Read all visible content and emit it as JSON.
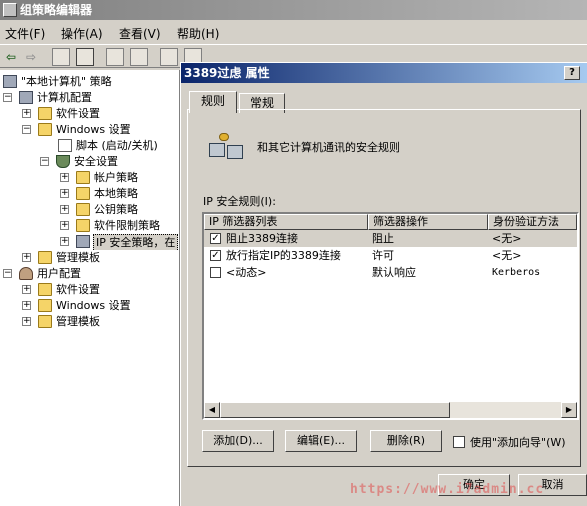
{
  "window": {
    "title": "组策略编辑器"
  },
  "menu": [
    "文件(F)",
    "操作(A)",
    "查看(V)",
    "帮助(H)"
  ],
  "toolbar": {
    "back": "⇦",
    "forward": "⇨"
  },
  "tree": {
    "items": [
      {
        "label": "\"本地计算机\" 策略"
      },
      {
        "label": "计算机配置"
      },
      {
        "label": "软件设置"
      },
      {
        "label": "Windows 设置"
      },
      {
        "label": "脚本 (启动/关机)"
      },
      {
        "label": "安全设置"
      },
      {
        "label": "帐户策略"
      },
      {
        "label": "本地策略"
      },
      {
        "label": "公钥策略"
      },
      {
        "label": "软件限制策略"
      },
      {
        "label": "IP 安全策略，在"
      },
      {
        "label": "管理模板"
      },
      {
        "label": "用户配置"
      },
      {
        "label": "软件设置"
      },
      {
        "label": "Windows 设置"
      },
      {
        "label": "管理模板"
      }
    ]
  },
  "dialog": {
    "title": "3389过虑 属性",
    "help_label": "?",
    "close_label": "×",
    "tabs": [
      "规则",
      "常规"
    ],
    "description": "和其它计算机通讯的安全规则",
    "list_label": "IP 安全规则(I):",
    "columns": [
      "IP 筛选器列表",
      "筛选器操作",
      "身份验证方法"
    ],
    "rows": [
      {
        "checked": "✓",
        "name": "阻止3389连接",
        "action": "阻止",
        "auth": "<无>"
      },
      {
        "checked": "✓",
        "name": "放行指定IP的3389连接",
        "action": "许可",
        "auth": "<无>"
      },
      {
        "checked": "",
        "name": "<动态>",
        "action": "默认响应",
        "auth": "Kerberos"
      }
    ],
    "buttons": {
      "add": "添加(D)...",
      "edit": "编辑(E)...",
      "remove": "删除(R)",
      "ok": "确定",
      "cancel": "取消"
    },
    "wizard_label": "使用\"添加向导\"(W)"
  },
  "watermark": "https://www.i7admin.cc"
}
